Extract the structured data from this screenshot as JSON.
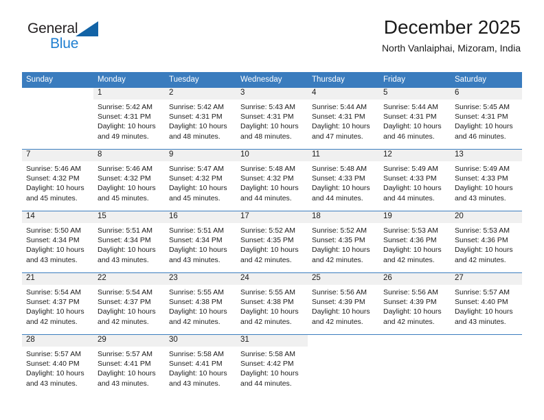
{
  "brand": {
    "name_top": "General",
    "name_bottom": "Blue",
    "accent_color": "#1f7fd0",
    "triangle_color": "#1263a6"
  },
  "header": {
    "title": "December 2025",
    "subtitle": "North Vanlaiphai, Mizoram, India",
    "header_bar_color": "#3a7cbe",
    "daynum_band_color": "#f0f0f0"
  },
  "weekdays": [
    "Sunday",
    "Monday",
    "Tuesday",
    "Wednesday",
    "Thursday",
    "Friday",
    "Saturday"
  ],
  "weeks": [
    [
      {
        "day": "",
        "blank": true,
        "sunrise": "",
        "sunset": "",
        "daylight1": "",
        "daylight2": ""
      },
      {
        "day": "1",
        "sunrise": "Sunrise: 5:42 AM",
        "sunset": "Sunset: 4:31 PM",
        "daylight1": "Daylight: 10 hours",
        "daylight2": "and 49 minutes."
      },
      {
        "day": "2",
        "sunrise": "Sunrise: 5:42 AM",
        "sunset": "Sunset: 4:31 PM",
        "daylight1": "Daylight: 10 hours",
        "daylight2": "and 48 minutes."
      },
      {
        "day": "3",
        "sunrise": "Sunrise: 5:43 AM",
        "sunset": "Sunset: 4:31 PM",
        "daylight1": "Daylight: 10 hours",
        "daylight2": "and 48 minutes."
      },
      {
        "day": "4",
        "sunrise": "Sunrise: 5:44 AM",
        "sunset": "Sunset: 4:31 PM",
        "daylight1": "Daylight: 10 hours",
        "daylight2": "and 47 minutes."
      },
      {
        "day": "5",
        "sunrise": "Sunrise: 5:44 AM",
        "sunset": "Sunset: 4:31 PM",
        "daylight1": "Daylight: 10 hours",
        "daylight2": "and 46 minutes."
      },
      {
        "day": "6",
        "sunrise": "Sunrise: 5:45 AM",
        "sunset": "Sunset: 4:31 PM",
        "daylight1": "Daylight: 10 hours",
        "daylight2": "and 46 minutes."
      }
    ],
    [
      {
        "day": "7",
        "sunrise": "Sunrise: 5:46 AM",
        "sunset": "Sunset: 4:32 PM",
        "daylight1": "Daylight: 10 hours",
        "daylight2": "and 45 minutes."
      },
      {
        "day": "8",
        "sunrise": "Sunrise: 5:46 AM",
        "sunset": "Sunset: 4:32 PM",
        "daylight1": "Daylight: 10 hours",
        "daylight2": "and 45 minutes."
      },
      {
        "day": "9",
        "sunrise": "Sunrise: 5:47 AM",
        "sunset": "Sunset: 4:32 PM",
        "daylight1": "Daylight: 10 hours",
        "daylight2": "and 45 minutes."
      },
      {
        "day": "10",
        "sunrise": "Sunrise: 5:48 AM",
        "sunset": "Sunset: 4:32 PM",
        "daylight1": "Daylight: 10 hours",
        "daylight2": "and 44 minutes."
      },
      {
        "day": "11",
        "sunrise": "Sunrise: 5:48 AM",
        "sunset": "Sunset: 4:33 PM",
        "daylight1": "Daylight: 10 hours",
        "daylight2": "and 44 minutes."
      },
      {
        "day": "12",
        "sunrise": "Sunrise: 5:49 AM",
        "sunset": "Sunset: 4:33 PM",
        "daylight1": "Daylight: 10 hours",
        "daylight2": "and 44 minutes."
      },
      {
        "day": "13",
        "sunrise": "Sunrise: 5:49 AM",
        "sunset": "Sunset: 4:33 PM",
        "daylight1": "Daylight: 10 hours",
        "daylight2": "and 43 minutes."
      }
    ],
    [
      {
        "day": "14",
        "sunrise": "Sunrise: 5:50 AM",
        "sunset": "Sunset: 4:34 PM",
        "daylight1": "Daylight: 10 hours",
        "daylight2": "and 43 minutes."
      },
      {
        "day": "15",
        "sunrise": "Sunrise: 5:51 AM",
        "sunset": "Sunset: 4:34 PM",
        "daylight1": "Daylight: 10 hours",
        "daylight2": "and 43 minutes."
      },
      {
        "day": "16",
        "sunrise": "Sunrise: 5:51 AM",
        "sunset": "Sunset: 4:34 PM",
        "daylight1": "Daylight: 10 hours",
        "daylight2": "and 43 minutes."
      },
      {
        "day": "17",
        "sunrise": "Sunrise: 5:52 AM",
        "sunset": "Sunset: 4:35 PM",
        "daylight1": "Daylight: 10 hours",
        "daylight2": "and 42 minutes."
      },
      {
        "day": "18",
        "sunrise": "Sunrise: 5:52 AM",
        "sunset": "Sunset: 4:35 PM",
        "daylight1": "Daylight: 10 hours",
        "daylight2": "and 42 minutes."
      },
      {
        "day": "19",
        "sunrise": "Sunrise: 5:53 AM",
        "sunset": "Sunset: 4:36 PM",
        "daylight1": "Daylight: 10 hours",
        "daylight2": "and 42 minutes."
      },
      {
        "day": "20",
        "sunrise": "Sunrise: 5:53 AM",
        "sunset": "Sunset: 4:36 PM",
        "daylight1": "Daylight: 10 hours",
        "daylight2": "and 42 minutes."
      }
    ],
    [
      {
        "day": "21",
        "sunrise": "Sunrise: 5:54 AM",
        "sunset": "Sunset: 4:37 PM",
        "daylight1": "Daylight: 10 hours",
        "daylight2": "and 42 minutes."
      },
      {
        "day": "22",
        "sunrise": "Sunrise: 5:54 AM",
        "sunset": "Sunset: 4:37 PM",
        "daylight1": "Daylight: 10 hours",
        "daylight2": "and 42 minutes."
      },
      {
        "day": "23",
        "sunrise": "Sunrise: 5:55 AM",
        "sunset": "Sunset: 4:38 PM",
        "daylight1": "Daylight: 10 hours",
        "daylight2": "and 42 minutes."
      },
      {
        "day": "24",
        "sunrise": "Sunrise: 5:55 AM",
        "sunset": "Sunset: 4:38 PM",
        "daylight1": "Daylight: 10 hours",
        "daylight2": "and 42 minutes."
      },
      {
        "day": "25",
        "sunrise": "Sunrise: 5:56 AM",
        "sunset": "Sunset: 4:39 PM",
        "daylight1": "Daylight: 10 hours",
        "daylight2": "and 42 minutes."
      },
      {
        "day": "26",
        "sunrise": "Sunrise: 5:56 AM",
        "sunset": "Sunset: 4:39 PM",
        "daylight1": "Daylight: 10 hours",
        "daylight2": "and 42 minutes."
      },
      {
        "day": "27",
        "sunrise": "Sunrise: 5:57 AM",
        "sunset": "Sunset: 4:40 PM",
        "daylight1": "Daylight: 10 hours",
        "daylight2": "and 43 minutes."
      }
    ],
    [
      {
        "day": "28",
        "sunrise": "Sunrise: 5:57 AM",
        "sunset": "Sunset: 4:40 PM",
        "daylight1": "Daylight: 10 hours",
        "daylight2": "and 43 minutes."
      },
      {
        "day": "29",
        "sunrise": "Sunrise: 5:57 AM",
        "sunset": "Sunset: 4:41 PM",
        "daylight1": "Daylight: 10 hours",
        "daylight2": "and 43 minutes."
      },
      {
        "day": "30",
        "sunrise": "Sunrise: 5:58 AM",
        "sunset": "Sunset: 4:41 PM",
        "daylight1": "Daylight: 10 hours",
        "daylight2": "and 43 minutes."
      },
      {
        "day": "31",
        "sunrise": "Sunrise: 5:58 AM",
        "sunset": "Sunset: 4:42 PM",
        "daylight1": "Daylight: 10 hours",
        "daylight2": "and 44 minutes."
      },
      {
        "day": "",
        "blank": true,
        "sunrise": "",
        "sunset": "",
        "daylight1": "",
        "daylight2": ""
      },
      {
        "day": "",
        "blank": true,
        "sunrise": "",
        "sunset": "",
        "daylight1": "",
        "daylight2": ""
      },
      {
        "day": "",
        "blank": true,
        "sunrise": "",
        "sunset": "",
        "daylight1": "",
        "daylight2": ""
      }
    ]
  ]
}
